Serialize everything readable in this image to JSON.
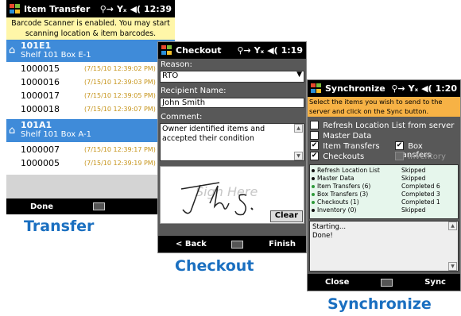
{
  "transfer": {
    "title": "Item Transfer",
    "clock": "12:39",
    "banner": "Barcode Scanner is enabled.  You may start scanning location & item barcodes.",
    "groups": [
      {
        "code": "101E1",
        "name": "Shelf 101 Box E-1",
        "items": [
          {
            "id": "1000015",
            "time": "(7/15/10 12:39:02 PM)"
          },
          {
            "id": "1000016",
            "time": "(7/15/10 12:39:03 PM)"
          },
          {
            "id": "1000017",
            "time": "(7/15/10 12:39:05 PM)"
          },
          {
            "id": "1000018",
            "time": "(7/15/10 12:39:07 PM)"
          }
        ]
      },
      {
        "code": "101A1",
        "name": "Shelf 101 Box A-1",
        "items": [
          {
            "id": "1000007",
            "time": "(7/15/10 12:39:17 PM)"
          },
          {
            "id": "1000005",
            "time": "(7/15/10 12:39:19 PM)"
          }
        ]
      }
    ],
    "done_label": "Done",
    "caption": "Transfer"
  },
  "checkout": {
    "title": "Checkout",
    "clock": "1:19",
    "reason_label": "Reason:",
    "reason_value": "RTO",
    "recipient_label": "Recipient Name:",
    "recipient_value": "John Smith",
    "comment_label": "Comment:",
    "comment_value": "Owner identified items and accepted their condition",
    "sign_here": "Sign Here",
    "clear_label": "Clear",
    "back_label": "< Back",
    "finish_label": "Finish",
    "caption": "Checkout"
  },
  "sync": {
    "title": "Synchronize",
    "clock": "1:20",
    "instructions": "Select the items you wish to send to the server and click on the Sync button.",
    "options": {
      "refresh": {
        "label": "Refresh Location List from server",
        "checked": false
      },
      "master": {
        "label": "Master Data",
        "checked": false
      },
      "item_transfers": {
        "label": "Item Transfers",
        "checked": true
      },
      "box_transfers": {
        "label": "Box Transfers",
        "checked": true
      },
      "checkouts": {
        "label": "Checkouts",
        "checked": true
      },
      "inventory": {
        "label": "Inventory",
        "checked": false
      }
    },
    "status": [
      {
        "name": "Refresh Location List",
        "state": "Skipped"
      },
      {
        "name": "Master Data",
        "state": "Skipped"
      },
      {
        "name": "Item Transfers (6)",
        "state": "Completed 6"
      },
      {
        "name": "Box Transfers (3)",
        "state": "Completed 3"
      },
      {
        "name": "Checkouts (1)",
        "state": "Completed 1"
      },
      {
        "name": "Inventory (0)",
        "state": "Skipped"
      }
    ],
    "log_line1": "Starting...",
    "log_line2": "Done!",
    "close_label": "Close",
    "sync_label": "Sync",
    "caption": "Synchronize"
  }
}
